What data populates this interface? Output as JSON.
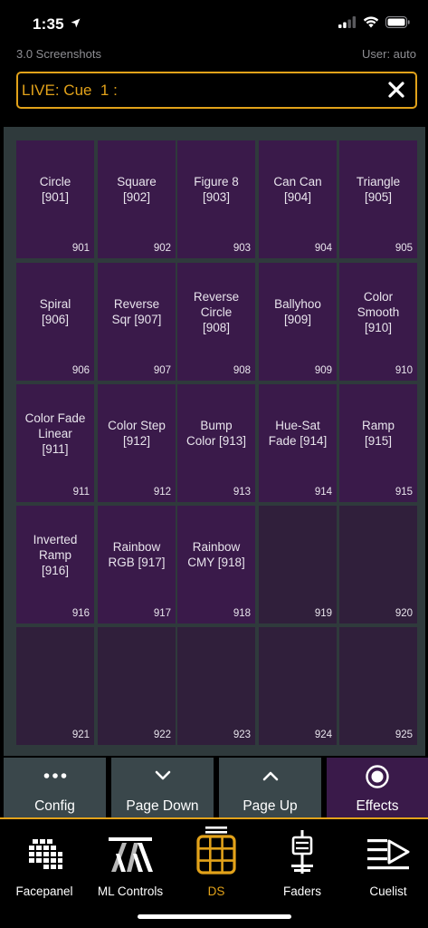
{
  "status": {
    "time": "1:35"
  },
  "info": {
    "show_name": "3.0 Screenshots",
    "user": "User: auto"
  },
  "cue": {
    "text": "LIVE: Cue  1 :"
  },
  "tiles": [
    {
      "label": "Circle\n[901]",
      "num": "901"
    },
    {
      "label": "Square\n[902]",
      "num": "902"
    },
    {
      "label": "Figure 8\n[903]",
      "num": "903"
    },
    {
      "label": "Can Can\n[904]",
      "num": "904"
    },
    {
      "label": "Triangle\n[905]",
      "num": "905"
    },
    {
      "label": "Spiral\n[906]",
      "num": "906"
    },
    {
      "label": "Reverse\nSqr [907]",
      "num": "907"
    },
    {
      "label": "Reverse\nCircle\n[908]",
      "num": "908"
    },
    {
      "label": "Ballyhoo\n[909]",
      "num": "909"
    },
    {
      "label": "Color\nSmooth\n[910]",
      "num": "910"
    },
    {
      "label": "Color Fade\nLinear\n[911]",
      "num": "911"
    },
    {
      "label": "Color Step\n[912]",
      "num": "912"
    },
    {
      "label": "Bump\nColor [913]",
      "num": "913"
    },
    {
      "label": "Hue-Sat\nFade [914]",
      "num": "914"
    },
    {
      "label": "Ramp\n[915]",
      "num": "915"
    },
    {
      "label": "Inverted\nRamp\n[916]",
      "num": "916"
    },
    {
      "label": "Rainbow\nRGB [917]",
      "num": "917"
    },
    {
      "label": "Rainbow\nCMY [918]",
      "num": "918"
    },
    {
      "label": "",
      "num": "919"
    },
    {
      "label": "",
      "num": "920"
    },
    {
      "label": "",
      "num": "921"
    },
    {
      "label": "",
      "num": "922"
    },
    {
      "label": "",
      "num": "923"
    },
    {
      "label": "",
      "num": "924"
    },
    {
      "label": "",
      "num": "925"
    }
  ],
  "softkeys": [
    {
      "label": "Config",
      "icon": "more-dots-icon"
    },
    {
      "label": "Page Down",
      "icon": "chevron-down-icon"
    },
    {
      "label": "Page Up",
      "icon": "chevron-up-icon"
    },
    {
      "label": "Effects",
      "icon": "effects-circle-icon"
    }
  ],
  "tabs": [
    {
      "label": "Facepanel",
      "icon": "facepanel-icon"
    },
    {
      "label": "ML Controls",
      "icon": "ml-controls-icon"
    },
    {
      "label": "DS",
      "icon": "ds-grid-icon"
    },
    {
      "label": "Faders",
      "icon": "faders-icon"
    },
    {
      "label": "Cuelist",
      "icon": "cuelist-icon"
    }
  ],
  "colors": {
    "accent": "#e2a21a",
    "tile_filled": "#3a1a4a",
    "tile_empty": "#301f3b",
    "grid_bg": "#2f3a3c",
    "softkey_bg": "#3a474b"
  }
}
